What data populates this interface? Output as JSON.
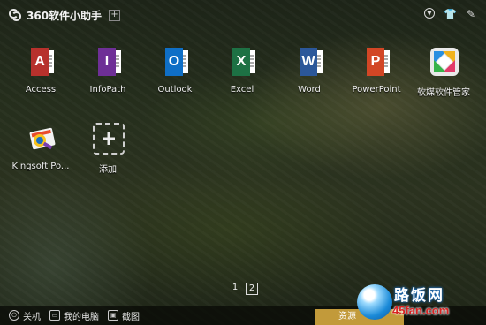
{
  "titlebar": {
    "title": "360软件小助手",
    "add_symbol": "+",
    "tools": [
      "chevron-down-icon",
      "shirt-icon",
      "pencil-icon"
    ]
  },
  "apps": [
    {
      "label": "Access",
      "letter": "A",
      "color": "#b7312c",
      "icon": "access-icon"
    },
    {
      "label": "InfoPath",
      "letter": "I",
      "color": "#6e2f96",
      "icon": "infopath-icon"
    },
    {
      "label": "Outlook",
      "letter": "O",
      "color": "#0f6fc6",
      "icon": "outlook-icon"
    },
    {
      "label": "Excel",
      "letter": "X",
      "color": "#1d7144",
      "icon": "excel-icon"
    },
    {
      "label": "Word",
      "letter": "W",
      "color": "#2b579a",
      "icon": "word-icon"
    },
    {
      "label": "PowerPoint",
      "letter": "P",
      "color": "#d24625",
      "icon": "powerpoint-icon"
    },
    {
      "label": "软媒软件管家",
      "icon": "software-manager-icon"
    },
    {
      "label": "Kingsoft Po...",
      "icon": "kingsoft-icon"
    },
    {
      "label": "添加",
      "icon": "add-icon"
    }
  ],
  "pager": {
    "pages": [
      "1",
      "2"
    ],
    "active": "2"
  },
  "bottombar": {
    "shutdown": "关机",
    "my_computer": "我的电脑",
    "screenshot": "截图",
    "resource": "资源"
  },
  "watermark": {
    "main": "路饭网",
    "sub": "45fan.com"
  }
}
